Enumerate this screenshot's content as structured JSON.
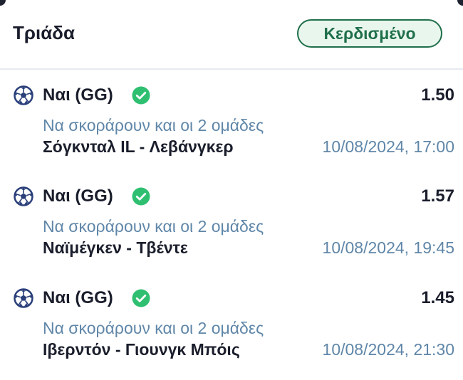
{
  "header": {
    "title": "Τριάδα",
    "status": "Κερδισμένο"
  },
  "colors": {
    "status_green": "#1f6f4a",
    "status_bg": "#e9f6ee",
    "check_green": "#2fbf71",
    "muted_blue": "#5f86a8",
    "ball_blue": "#2a3f7a"
  },
  "bets": [
    {
      "icon": "soccer-ball-icon",
      "selection": "Ναι (GG)",
      "result_icon": "check-circle-icon",
      "odds": "1.50",
      "market": "Να σκοράρουν και οι 2 ομάδες",
      "match": "Σόγκνταλ IL - Λεβάνγκερ",
      "datetime": "10/08/2024, 17:00"
    },
    {
      "icon": "soccer-ball-icon",
      "selection": "Ναι (GG)",
      "result_icon": "check-circle-icon",
      "odds": "1.57",
      "market": "Να σκοράρουν και οι 2 ομάδες",
      "match": "Ναϊμέγκεν - Τβέντε",
      "datetime": "10/08/2024, 19:45"
    },
    {
      "icon": "soccer-ball-icon",
      "selection": "Ναι (GG)",
      "result_icon": "check-circle-icon",
      "odds": "1.45",
      "market": "Να σκοράρουν και οι 2 ομάδες",
      "match": "Ιβερντόν - Γιουνγκ Μπόις",
      "datetime": "10/08/2024, 21:30"
    }
  ]
}
